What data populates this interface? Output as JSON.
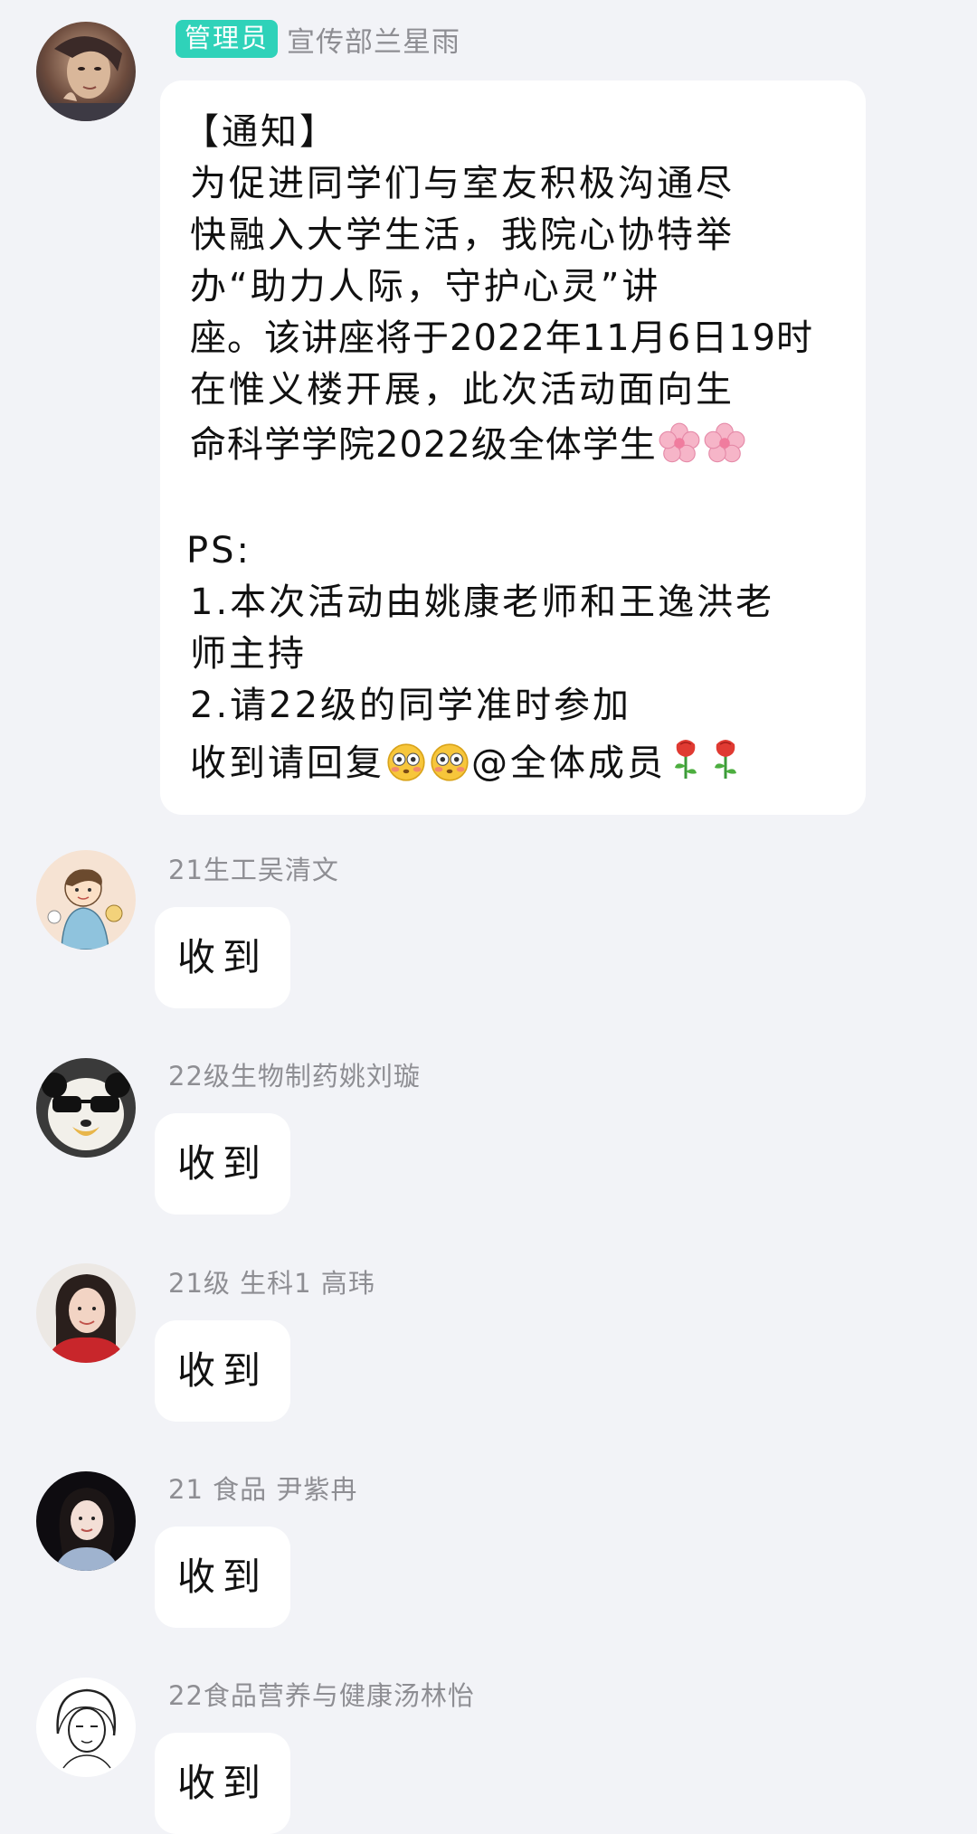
{
  "colors": {
    "background": "#f2f3f7",
    "bubble": "#ffffff",
    "admin_badge": "#2fd2b9",
    "sender_name": "#8e8e93"
  },
  "messages": [
    {
      "role_badge": "管理员",
      "sender": "宣传部兰星雨",
      "avatar_icon": "portrait-avatar",
      "lines": {
        "line1": "【通知】",
        "line2": "为促进同学们与室友积极沟通尽",
        "line3": "快融入大学生活，我院心协特举",
        "line4": "办“助力人际，守护心灵”讲",
        "line5": "座。该讲座将于2022年11月6日19时",
        "line6": "在惟义楼开展，此次活动面向生",
        "line7_text": "命科学学院2022级全体学生",
        "line8": "PS:",
        "line9": "1.本次活动由姚康老师和王逸洪老",
        "line10": "师主持",
        "line11": "2.请22级的同学准时参加",
        "line12_prefix": "收到请回复",
        "line12_mention": "@全体成员"
      },
      "emoji_icons": [
        "cherry-blossom-icon",
        "cherry-blossom-icon",
        "flushed-face-icon",
        "flushed-face-icon",
        "rose-icon",
        "rose-icon"
      ]
    },
    {
      "sender": "21生工吴清文",
      "text": "收到",
      "avatar_icon": "cartoon-boy-avatar"
    },
    {
      "sender": "22级生物制药姚刘璇",
      "text": "收到",
      "avatar_icon": "panda-sunglasses-avatar"
    },
    {
      "sender": "21级 生科1 高玮",
      "text": "收到",
      "avatar_icon": "girl-red-avatar"
    },
    {
      "sender": "21 食品 尹紫冉",
      "text": "收到",
      "avatar_icon": "girl-dark-avatar"
    },
    {
      "sender": "22食品营养与健康汤林怡",
      "text": "收到",
      "avatar_icon": "sketch-girl-avatar"
    }
  ]
}
